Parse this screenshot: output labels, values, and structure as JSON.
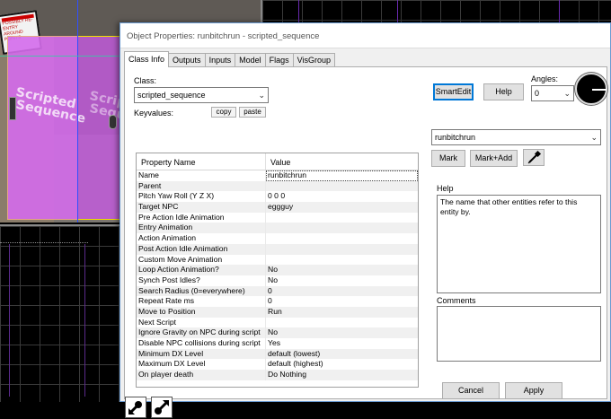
{
  "viewport_3d": {
    "sign_text": "POSSIBLY RE-ENTRY AROUND POINTS",
    "entity_text": "Scripted Sequence"
  },
  "dialog": {
    "title": "Object Properties: runbitchrun - scripted_sequence",
    "tabs": [
      {
        "label": "Class Info",
        "active": true
      },
      {
        "label": "Outputs",
        "active": false
      },
      {
        "label": "Inputs",
        "active": false
      },
      {
        "label": "Model",
        "active": false
      },
      {
        "label": "Flags",
        "active": false
      },
      {
        "label": "VisGroup",
        "active": false
      }
    ],
    "class_label": "Class:",
    "class_value": "scripted_sequence",
    "keyvalues_label": "Keyvalues:",
    "copy_label": "copy",
    "paste_label": "paste",
    "smartedit_label": "SmartEdit",
    "help_button_label": "Help",
    "angles_label": "Angles:",
    "angles_value": "0",
    "property_grid": {
      "header_name": "Property Name",
      "header_value": "Value",
      "rows": [
        {
          "name": "Name",
          "value": "runbitchrun"
        },
        {
          "name": "Parent",
          "value": ""
        },
        {
          "name": "Pitch Yaw Roll (Y Z X)",
          "value": "0 0 0"
        },
        {
          "name": "Target NPC",
          "value": "eggguy"
        },
        {
          "name": "Pre Action Idle Animation",
          "value": ""
        },
        {
          "name": "Entry Animation",
          "value": ""
        },
        {
          "name": "Action Animation",
          "value": ""
        },
        {
          "name": "Post Action Idle Animation",
          "value": ""
        },
        {
          "name": "Custom Move Animation",
          "value": ""
        },
        {
          "name": "Loop Action Animation?",
          "value": "No"
        },
        {
          "name": "Synch Post Idles?",
          "value": "No"
        },
        {
          "name": "Search Radius (0=everywhere)",
          "value": "0"
        },
        {
          "name": "Repeat Rate ms",
          "value": "0"
        },
        {
          "name": "Move to Position",
          "value": "Run"
        },
        {
          "name": "Next Script",
          "value": ""
        },
        {
          "name": "Ignore Gravity on NPC during script",
          "value": "No"
        },
        {
          "name": "Disable NPC collisions during script",
          "value": "Yes"
        },
        {
          "name": "Minimum DX Level",
          "value": "default (lowest)"
        },
        {
          "name": "Maximum DX Level",
          "value": "default (highest)"
        },
        {
          "name": "On player death",
          "value": "Do Nothing"
        }
      ]
    },
    "value_combo": "runbitchrun",
    "mark_label": "Mark",
    "mark_add_label": "Mark+Add",
    "help_section_label": "Help",
    "help_text": "The name that other entities refer to this entity by.",
    "comments_label": "Comments",
    "comments_value": "",
    "cancel_label": "Cancel",
    "apply_label": "Apply"
  },
  "colors": {
    "accent": "#0078d7",
    "entity_brush": "#c85ae6",
    "selection_outline": "#f0e000"
  },
  "icons": {
    "angle_dial": "angle-dial",
    "picker": "eyedropper-icon",
    "tool_1": "arrow-down-left-icon",
    "tool_2": "arrow-up-right-icon"
  }
}
